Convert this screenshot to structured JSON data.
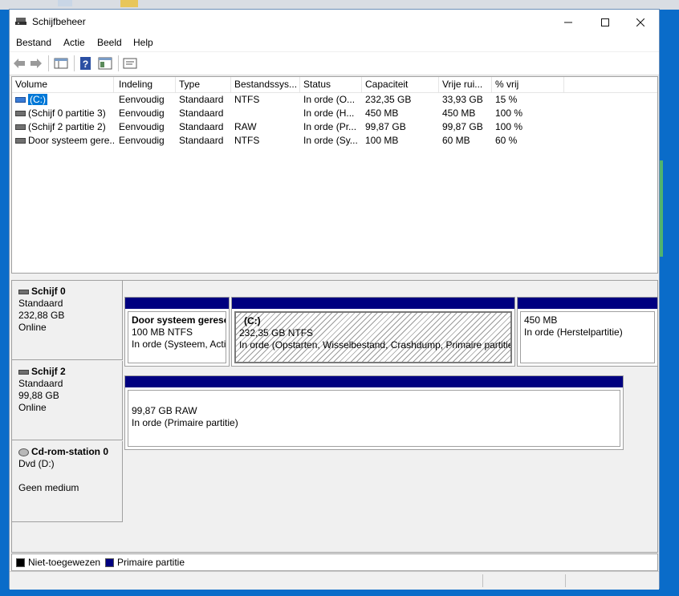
{
  "window": {
    "title": "Schijfbeheer"
  },
  "menu": [
    "Bestand",
    "Actie",
    "Beeld",
    "Help"
  ],
  "toolbar": {
    "icons": [
      "back-arrow-icon",
      "forward-arrow-icon",
      "disk-list-icon",
      "help-icon",
      "properties-icon",
      "console-icon"
    ]
  },
  "volume_list": {
    "columns": [
      "Volume",
      "Indeling",
      "Type",
      "Bestandssys...",
      "Status",
      "Capaciteit",
      "Vrije rui...",
      "% vrij"
    ],
    "rows": [
      {
        "volume": "(C:)",
        "indeling": "Eenvoudig",
        "type": "Standaard",
        "fs": "NTFS",
        "status": "In orde (O...",
        "capaciteit": "232,35 GB",
        "vrij": "33,93 GB",
        "pct": "15 %",
        "selected": true
      },
      {
        "volume": "(Schijf 0 partitie 3)",
        "indeling": "Eenvoudig",
        "type": "Standaard",
        "fs": "",
        "status": "In orde (H...",
        "capaciteit": "450 MB",
        "vrij": "450 MB",
        "pct": "100 %",
        "selected": false
      },
      {
        "volume": "(Schijf 2 partitie 2)",
        "indeling": "Eenvoudig",
        "type": "Standaard",
        "fs": "RAW",
        "status": "In orde (Pr...",
        "capaciteit": "99,87 GB",
        "vrij": "99,87 GB",
        "pct": "100 %",
        "selected": false
      },
      {
        "volume": "Door systeem gere...",
        "indeling": "Eenvoudig",
        "type": "Standaard",
        "fs": "NTFS",
        "status": "In orde (Sy...",
        "capaciteit": "100 MB",
        "vrij": "60 MB",
        "pct": "60 %",
        "selected": false
      }
    ]
  },
  "disks": [
    {
      "name": "Schijf 0",
      "kind": "Standaard",
      "size": "232,88 GB",
      "state": "Online",
      "partitions": [
        {
          "title": "Door systeem gerese",
          "line1": "100 MB NTFS",
          "line2": "In orde (Systeem, Actie"
        },
        {
          "title": "(C:)",
          "line1": "232,35 GB NTFS",
          "line2": "In orde (Opstarten, Wisselbestand, Crashdump, Primaire partitie)"
        },
        {
          "title": "",
          "line1": "450 MB",
          "line2": "In orde (Herstelpartitie)"
        }
      ]
    },
    {
      "name": "Schijf 2",
      "kind": "Standaard",
      "size": "99,88 GB",
      "state": "Online",
      "partitions": [
        {
          "title": "",
          "line1": "99,87 GB RAW",
          "line2": "In orde (Primaire partitie)"
        }
      ]
    },
    {
      "name": "Cd-rom-station 0",
      "kind": "Dvd (D:)",
      "size": "",
      "state": "Geen medium",
      "partitions": []
    }
  ],
  "legend": [
    {
      "label": "Niet-toegewezen",
      "color": "#000000"
    },
    {
      "label": "Primaire partitie",
      "color": "#000080"
    }
  ]
}
